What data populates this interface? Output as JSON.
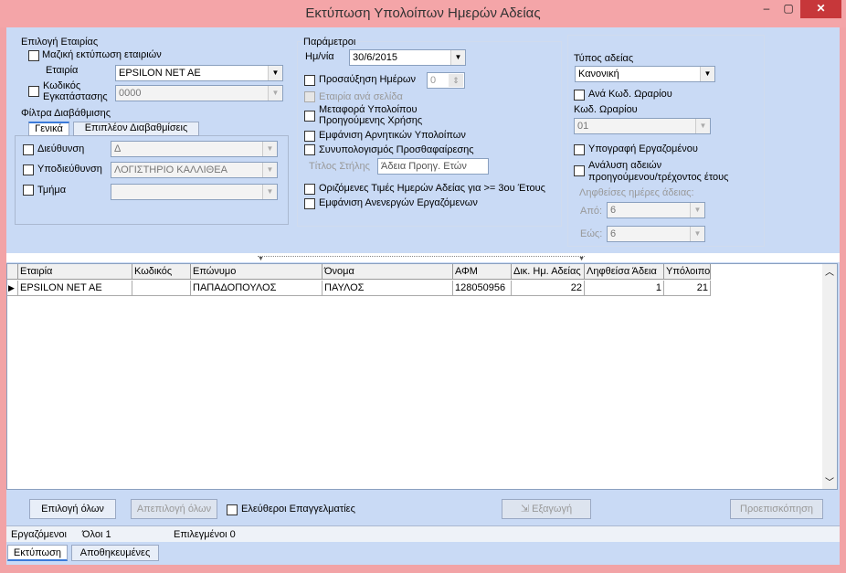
{
  "window": {
    "title": "Εκτύπωση Υπολοίπων Ημερών Αδείας"
  },
  "company": {
    "section": "Επιλογή Εταιρίας",
    "bulk_print": "Μαζική εκτύπωση εταιριών",
    "company_label": "Εταιρία",
    "company_value": "EPSILON NET AE",
    "install_code_label": "Κωδικός\nΕγκατάστασης",
    "install_code_value": "0000"
  },
  "filters": {
    "section": "Φίλτρα Διαβάθμισης",
    "tab_general": "Γενικά",
    "tab_more": "Επιπλέον Διαβαθμίσεις",
    "direction_label": "Διεύθυνση",
    "direction_value": "Δ",
    "subdirection_label": "Υποδιεύθυνση",
    "subdirection_value": "ΛΟΓΙΣΤΗΡΙΟ ΚΑΛΛΙΘΕΑ",
    "department_label": "Τμήμα",
    "department_value": ""
  },
  "params": {
    "section": "Παράμετροι",
    "date_label": "Ημ/νία",
    "date_value": "30/6/2015",
    "increase_days": "Προσαύξηση Ημέρων",
    "increase_value": "0",
    "company_per_page": "Εταιρία ανά σελίδα",
    "carry_over": "Μεταφορά Υπολοίπου\nΠροηγούμενης Χρήσης",
    "show_negative": "Εμφάνιση Αρνητικών Υπολοίπων",
    "offsetting": "Συνυπολογισμός Προσθαφαίρεσης",
    "column_title_label": "Τίτλος Στήλης",
    "column_title_value": "Άδεια Προηγ. Ετών",
    "horizontal_values": "Οριζόμενες Τιμές Ημερών Αδείας  για >= 3ου Έτους",
    "show_inactive": "Εμφάνιση Ανενεργών Εργαζόμενων"
  },
  "leave": {
    "type_label": "Τύπος αδείας",
    "type_value": "Κανονική",
    "per_schedule": "Ανά Κωδ. Ωραρίου",
    "schedule_label": "Κωδ. Ωραρίου",
    "schedule_value": "01",
    "employee_signature": "Υπογραφή Εργαζομένου",
    "analysis": "Ανάλυση αδειών\nπροηγούμενου/τρέχοντος έτους",
    "taken_days_label": "Ληφθείσες ημέρες άδειας:",
    "from_label": "Από:",
    "from_value": "6",
    "to_label": "Εώς:",
    "to_value": "6"
  },
  "grid": {
    "columns": [
      "Εταιρία",
      "Κωδικός",
      "Επώνυμο",
      "Όνομα",
      "ΑΦΜ",
      "Δικ. Ημ. Αδείας",
      "Ληφθείσα Άδεια",
      "Υπόλοιπο"
    ],
    "rows": [
      {
        "company": "EPSILON NET AE",
        "code": "",
        "surname": "ΠΑΠΑΔΟΠΟΥΛΟΣ",
        "name": "ΠΑΥΛΟΣ",
        "afm": "128050956",
        "entitled": "22",
        "taken": "1",
        "balance": "21"
      }
    ]
  },
  "actions": {
    "select_all": "Επιλογή όλων",
    "deselect_all": "Απεπιλογή όλων",
    "freelancers": "Ελεύθεροι Επαγγελματίες",
    "export": "Εξαγωγή",
    "preview": "Προεπισκόπηση"
  },
  "status": {
    "employees": "Εργαζόμενοι",
    "all": "Όλοι 1",
    "selected": "Επιλεγμένοι 0"
  },
  "bottom_tabs": {
    "print": "Εκτύπωση",
    "saved": "Αποθηκευμένες"
  }
}
